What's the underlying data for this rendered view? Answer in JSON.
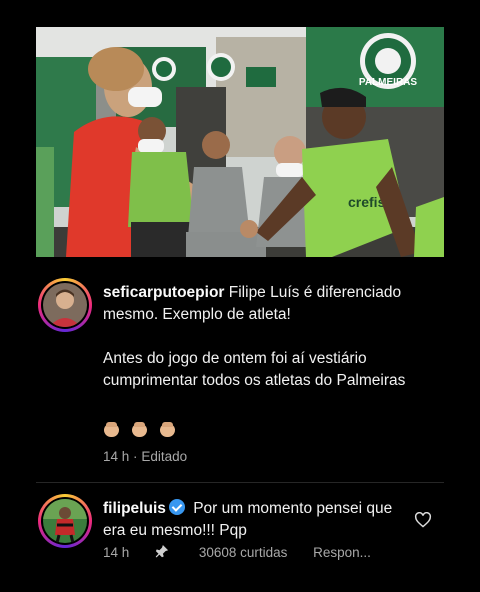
{
  "post_image": {
    "alt_icon": "photo-locker-room",
    "logos_text": "PALMEIRAS",
    "jersey_sponsor": "crefisa"
  },
  "comment1": {
    "username": "seficarputoepior",
    "line1": "Filipe Luís é diferenciado mesmo. Exemplo de atleta!",
    "line2": "Antes do jogo de ontem foi aí vestiário cumprimentar todos os atletas do Palmeiras",
    "emojis": [
      "clap-icon",
      "clap-icon",
      "clap-icon"
    ],
    "time": "14 h",
    "separator": "·",
    "edited": "Editado"
  },
  "comment2": {
    "username": "filipeluis",
    "verified": true,
    "text": "Por um momento pensei que era eu mesmo!!! Pqp",
    "time": "14 h",
    "likes": "30608 curtidas",
    "reply": "Respon..."
  },
  "colors": {
    "background": "#000000",
    "text": "#f2f2f2",
    "meta": "#a8a8a8",
    "verified": "#3897f0",
    "palmeiras_green": "#1f6b3f"
  }
}
